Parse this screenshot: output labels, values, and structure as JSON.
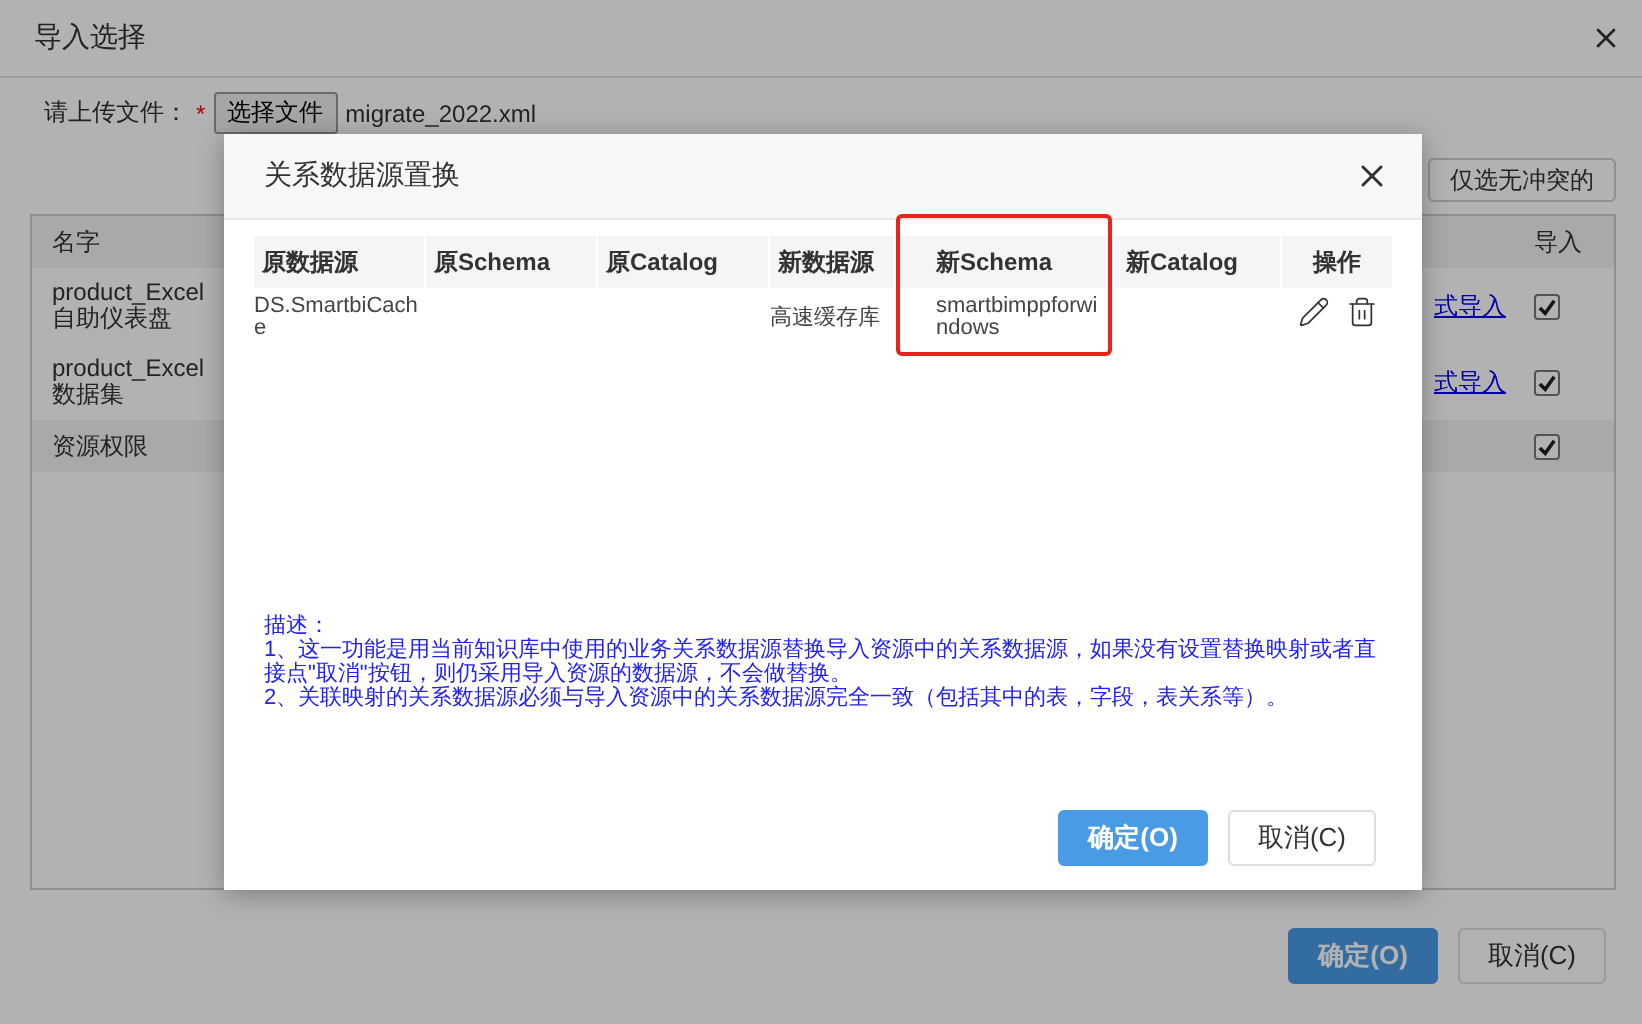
{
  "dialog": {
    "title": "导入选择",
    "upload": {
      "label": "请上传文件：",
      "required_mark": "*",
      "button": "选择文件",
      "file_name": "migrate_2022.xml"
    },
    "filter_button": "仅选无冲突的",
    "table": {
      "columns": [
        "名字",
        "导入"
      ],
      "rows": [
        {
          "name": "product_Excel自助仪表盘",
          "link": "式导入",
          "checked": true,
          "shaded": false
        },
        {
          "name": "product_Excel数据集",
          "link": "式导入",
          "checked": true,
          "shaded": false
        },
        {
          "name": "资源权限",
          "checked": true,
          "shaded": true
        }
      ]
    },
    "buttons": [
      {
        "label": "确定(O)",
        "kind": "primary"
      },
      {
        "label": "取消(C)",
        "kind": "secondary"
      }
    ]
  },
  "modal": {
    "title": "关系数据源置换",
    "columns": [
      {
        "label": "原数据源",
        "highlighted": false
      },
      {
        "label": "原Schema",
        "highlighted": false
      },
      {
        "label": "原Catalog",
        "highlighted": false
      },
      {
        "label": "新数据源",
        "highlighted": false
      },
      {
        "label": "新Schema",
        "highlighted": true
      },
      {
        "label": "新Catalog",
        "highlighted": false
      },
      {
        "label": "操作",
        "highlighted": false
      }
    ],
    "rows": [
      {
        "cells": [
          "DS.SmartbiCache",
          "",
          "",
          "高速缓存库",
          "smartbimppforwindows",
          ""
        ]
      }
    ],
    "description": [
      "描述：",
      "1、这一功能是用当前知识库中使用的业务关系数据源替换导入资源中的关系数据源，如果没有设置替换映射或者直接点\"取消\"按钮，则仍采用导入资源的数据源，不会做替换。",
      "2、关联映射的关系数据源必须与导入资源中的关系数据源完全一致（包括其中的表，字段，表关系等）。"
    ],
    "buttons": [
      {
        "label": "确定(O)",
        "kind": "primary"
      },
      {
        "label": "取消(C)",
        "kind": "secondary"
      }
    ]
  }
}
